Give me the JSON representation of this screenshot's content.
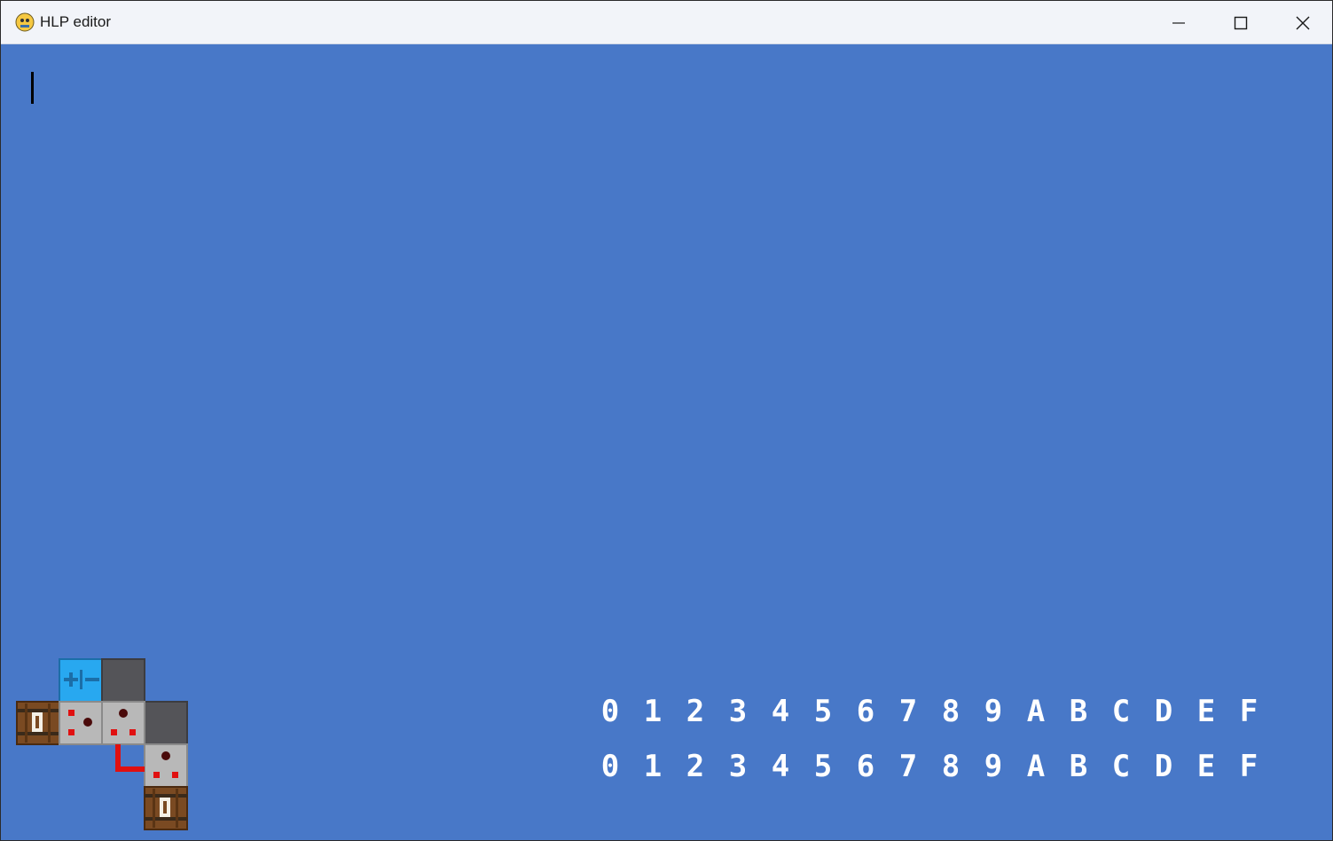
{
  "window": {
    "title": "HLP editor"
  },
  "hex_rows": [
    {
      "digits": [
        "0",
        "1",
        "2",
        "3",
        "4",
        "5",
        "6",
        "7",
        "8",
        "9",
        "A",
        "B",
        "C",
        "D",
        "E",
        "F"
      ]
    },
    {
      "digits": [
        "0",
        "1",
        "2",
        "3",
        "4",
        "5",
        "6",
        "7",
        "8",
        "9",
        "A",
        "B",
        "C",
        "D",
        "E",
        "F"
      ]
    }
  ],
  "icons": {
    "app": "python-pygame-icon",
    "minimize": "minimize-icon",
    "maximize": "maximize-icon",
    "close": "close-icon"
  },
  "colors": {
    "background": "#4878c8",
    "titlebar": "#f2f4f9",
    "hex_text": "#ffffff",
    "tile_gray": "#b8b8b8",
    "tile_dark": "#545458",
    "tile_cyan": "#28a8f0",
    "wire_red": "#e01010",
    "barrel_wood": "#7a4a22"
  }
}
